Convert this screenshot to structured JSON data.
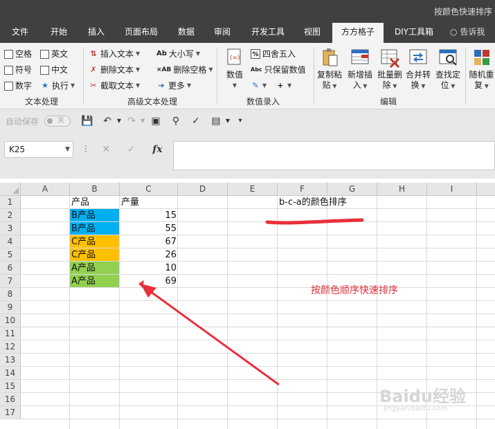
{
  "window": {
    "title": "按颜色快速排序"
  },
  "tabs": [
    {
      "label": "文件"
    },
    {
      "label": "开始"
    },
    {
      "label": "插入"
    },
    {
      "label": "页面布局"
    },
    {
      "label": "数据"
    },
    {
      "label": "审阅"
    },
    {
      "label": "开发工具"
    },
    {
      "label": "视图"
    },
    {
      "label": "方方格子"
    },
    {
      "label": "DIY工具箱"
    }
  ],
  "tell_me": "告诉我",
  "ribbon": {
    "text_group": {
      "label": "文本处理",
      "checkboxes": [
        "空格",
        "英文",
        "符号",
        "中文",
        "数字"
      ],
      "execute": "执行"
    },
    "adv_group": {
      "label": "高级文本处理",
      "insert_text": "插入文本",
      "delete_text": "删除文本",
      "extract_text": "截取文本",
      "case": "大小写",
      "delete_space": "删除空格",
      "more": "更多"
    },
    "num_group": {
      "label": "数值录入",
      "value": "数值",
      "round": "四舍五入",
      "keep_value": "只保留数值"
    },
    "edit_group": {
      "label": "编辑",
      "copy_paste": [
        "复制粘",
        "贴"
      ],
      "insert": [
        "新增插",
        "入"
      ],
      "batch_delete": [
        "批量删",
        "除"
      ],
      "merge": [
        "合并转",
        "换"
      ],
      "find": [
        "查找定",
        "位"
      ]
    },
    "random": [
      "随机重",
      "复"
    ]
  },
  "qat": {
    "autosave": "自动保存",
    "toggle": "关"
  },
  "formula_bar": {
    "name_box": "K25",
    "formula": ""
  },
  "grid": {
    "columns": [
      "A",
      "B",
      "C",
      "D",
      "E",
      "F",
      "G",
      "H",
      "I"
    ],
    "rows": [
      "1",
      "2",
      "3",
      "4",
      "5",
      "6",
      "7",
      "8",
      "9",
      "10",
      "11",
      "12",
      "13",
      "14",
      "15",
      "16",
      "17"
    ],
    "header_product": "产品",
    "header_qty": "产量",
    "data": [
      {
        "product": "B产品",
        "qty": "15",
        "color": "#00b0f0"
      },
      {
        "product": "B产品",
        "qty": "55",
        "color": "#00b0f0"
      },
      {
        "product": "C产品",
        "qty": "67",
        "color": "#ffc000"
      },
      {
        "product": "C产品",
        "qty": "26",
        "color": "#ffc000"
      },
      {
        "product": "A产品",
        "qty": "10",
        "color": "#92d050"
      },
      {
        "product": "A产品",
        "qty": "69",
        "color": "#92d050"
      }
    ],
    "order_note": "b-c-a的颜色排序",
    "red_note": "按颜色顺序快速排序"
  },
  "colors": {
    "annotation_red": "#e8303a",
    "blue_fill": "#00b0f0",
    "orange_fill": "#ffc000",
    "green_fill": "#92d050"
  },
  "watermark": {
    "main": "Baidu经验",
    "sub": "jingyan.baidu.com"
  }
}
